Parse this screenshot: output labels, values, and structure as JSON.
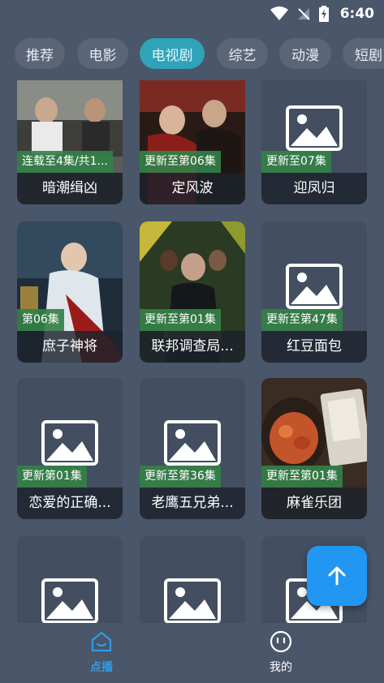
{
  "status_bar": {
    "time": "6:40"
  },
  "tabs": [
    {
      "label": "推荐",
      "active": false
    },
    {
      "label": "电影",
      "active": false
    },
    {
      "label": "电视剧",
      "active": true
    },
    {
      "label": "综艺",
      "active": false
    },
    {
      "label": "动漫",
      "active": false
    },
    {
      "label": "短剧",
      "active": false
    }
  ],
  "cards": [
    {
      "title": "暗潮缉凶",
      "badge": "连载至4集/共1...",
      "thumb": "poster"
    },
    {
      "title": "定风波",
      "badge": "更新至第06集",
      "thumb": "poster"
    },
    {
      "title": "迎凤归",
      "badge": "更新至07集",
      "thumb": "placeholder"
    },
    {
      "title": "庶子神将",
      "badge": "第06集",
      "thumb": "poster"
    },
    {
      "title": "联邦调查局...",
      "badge": "更新至第01集",
      "thumb": "poster"
    },
    {
      "title": "红豆面包",
      "badge": "更新至第47集",
      "thumb": "placeholder"
    },
    {
      "title": "恋爱的正确...",
      "badge": "更新第01集",
      "thumb": "placeholder"
    },
    {
      "title": "老鹰五兄弟...",
      "badge": "更新至第36集",
      "thumb": "placeholder"
    },
    {
      "title": "麻雀乐团",
      "badge": "更新至第01集",
      "thumb": "poster"
    },
    {
      "title": "",
      "badge": "",
      "thumb": "placeholder"
    },
    {
      "title": "",
      "badge": "",
      "thumb": "placeholder"
    },
    {
      "title": "",
      "badge": "",
      "thumb": "placeholder"
    }
  ],
  "bottom_nav": {
    "items": [
      {
        "label": "点播",
        "icon": "home-icon",
        "active": true
      },
      {
        "label": "我的",
        "icon": "smiley-icon",
        "active": false
      }
    ]
  },
  "fab": {
    "icon": "arrow-up-icon"
  },
  "colors": {
    "background": "#4a5669",
    "active_tab": "#2fa3b8",
    "badge": "#348048",
    "fab": "#2196f3",
    "nav_active": "#2f9de6"
  }
}
